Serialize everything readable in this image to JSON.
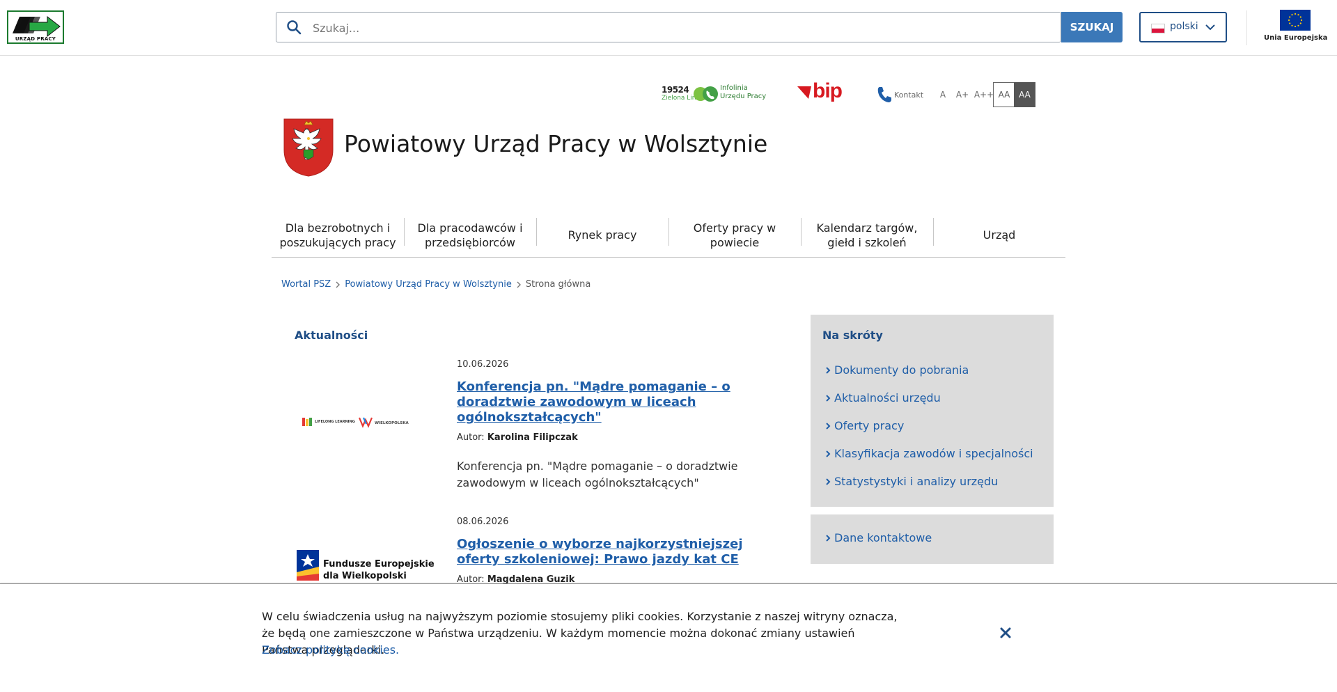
{
  "header": {
    "logo_text": "URZĄD PRACY",
    "search": {
      "placeholder": "Szukaj...",
      "button_label": "SZUKAJ"
    },
    "language": {
      "selected": "polski"
    },
    "eu_label": "Unia Europejska"
  },
  "utility": {
    "infolinia_number": "19524",
    "infolinia_sub": "Zielona Linia",
    "infolinia_label_1": "Infolinia",
    "infolinia_label_2": "Urzędu Pracy",
    "bip_text": "bip",
    "kontakt_label": "Kontakt",
    "font_sizes": [
      "A",
      "A+",
      "A++"
    ],
    "contrast_labels": [
      "AA",
      "AA"
    ]
  },
  "institution": {
    "title": "Powiatowy Urząd Pracy w Wolsztynie"
  },
  "nav": {
    "items": [
      {
        "line1": "Dla bezrobotnych i",
        "line2": "poszukujących pracy"
      },
      {
        "line1": "Dla pracodawców i",
        "line2": "przedsiębiorców"
      },
      {
        "line1": "Rynek pracy",
        "line2": ""
      },
      {
        "line1": "Oferty pracy w",
        "line2": "powiecie"
      },
      {
        "line1": "Kalendarz targów,",
        "line2": "giełd i szkoleń"
      },
      {
        "line1": "Urząd",
        "line2": ""
      }
    ]
  },
  "breadcrumb": {
    "items": [
      "Wortal PSZ",
      "Powiatowy Urząd Pracy w Wolsztynie"
    ],
    "current": "Strona główna"
  },
  "news": {
    "section_title": "Aktualności",
    "author_prefix": "Autor:",
    "items": [
      {
        "date": "10.06.2026",
        "title": "Konferencja pn. \"Mądre pomaganie – o doradztwie zawodowym w liceach ogólnokształcących\"",
        "author": "Karolina Filipczak",
        "excerpt": "Konferencja pn. \"Mądre pomaganie – o doradztwie zawodowym w liceach ogólnokształcących\"",
        "thumb_text_1": "LIFELONG LEARNING",
        "thumb_text_2": "WIELKOPOLSKA"
      },
      {
        "date": "08.06.2026",
        "title": "Ogłoszenie o wyborze najkorzystniejszej oferty szkoleniowej: Prawo jazdy kat CE",
        "author": "Magdalena Guzik",
        "thumb_text_1": "Fundusze Europejskie",
        "thumb_text_2": "dla Wielkopolski"
      }
    ]
  },
  "sidebar": {
    "title": "Na skróty",
    "links": [
      "Dokumenty do pobrania",
      "Aktualności urzędu",
      "Oferty pracy",
      "Klasyfikacja zawodów i specjalności",
      "Statystystyki i analizy urzędu"
    ],
    "contact_link": "Dane kontaktowe"
  },
  "cookie": {
    "text": "W celu świadczenia usług na najwyższym poziomie stosujemy pliki cookies. Korzystanie z naszej witryny oznacza, że będą one zamieszczone w Państwa urządzeniu. W każdym momencie można dokonać zmiany ustawień Państwa przeglądarki.",
    "link": "Zobacz politykę cookies."
  },
  "colors": {
    "primary_blue": "#1f4e86",
    "link_blue": "#1f5ea8",
    "search_button": "#3b78b8",
    "logo_green": "#1b7a2e",
    "bip_red": "#d71920",
    "sidebar_bg": "#dcdcdc"
  },
  "icons": {
    "search": "search-icon",
    "lang_dropdown": "chevron-down-icon",
    "kontakt": "phone-icon",
    "infolinia": "phone-bubble-icon",
    "sidebar_links": "chevron-right-icon",
    "cookie_close": "close-icon"
  }
}
